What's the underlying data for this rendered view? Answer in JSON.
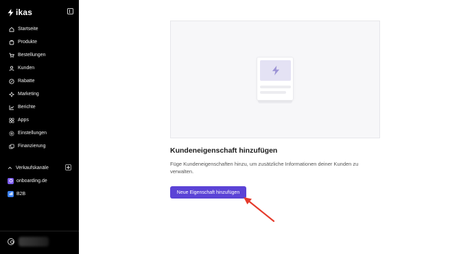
{
  "brand": {
    "name": "ikas"
  },
  "nav": {
    "items": [
      {
        "label": "Startseite",
        "icon": "home-icon"
      },
      {
        "label": "Produkte",
        "icon": "package-icon"
      },
      {
        "label": "Bestellungen",
        "icon": "cart-icon"
      },
      {
        "label": "Kunden",
        "icon": "user-icon"
      },
      {
        "label": "Rabatte",
        "icon": "discount-icon"
      },
      {
        "label": "Marketing",
        "icon": "megaphone-icon"
      },
      {
        "label": "Berichte",
        "icon": "chart-icon"
      },
      {
        "label": "Apps",
        "icon": "apps-icon"
      },
      {
        "label": "Einstellungen",
        "icon": "gear-icon"
      },
      {
        "label": "Finanzierung",
        "icon": "finance-icon"
      }
    ]
  },
  "channels": {
    "header": "Verkaufskanäle",
    "items": [
      {
        "label": "onboarding.de",
        "icon": "store-icon",
        "color": "#7c5cf2"
      },
      {
        "label": "B2B",
        "icon": "b2b-icon",
        "color": "#3b82f6"
      }
    ]
  },
  "empty_state": {
    "title": "Kundeneigenschaft hinzufügen",
    "description": "Füge Kundeneigenschaften hinzu, um zusätzliche Informationen deiner Kunden zu verwalten.",
    "button_label": "Neue Eigenschaft hinzufügen"
  },
  "colors": {
    "sidebar_bg": "#000000",
    "accent": "#5b43d6",
    "annotation_arrow": "#e53b2c"
  }
}
